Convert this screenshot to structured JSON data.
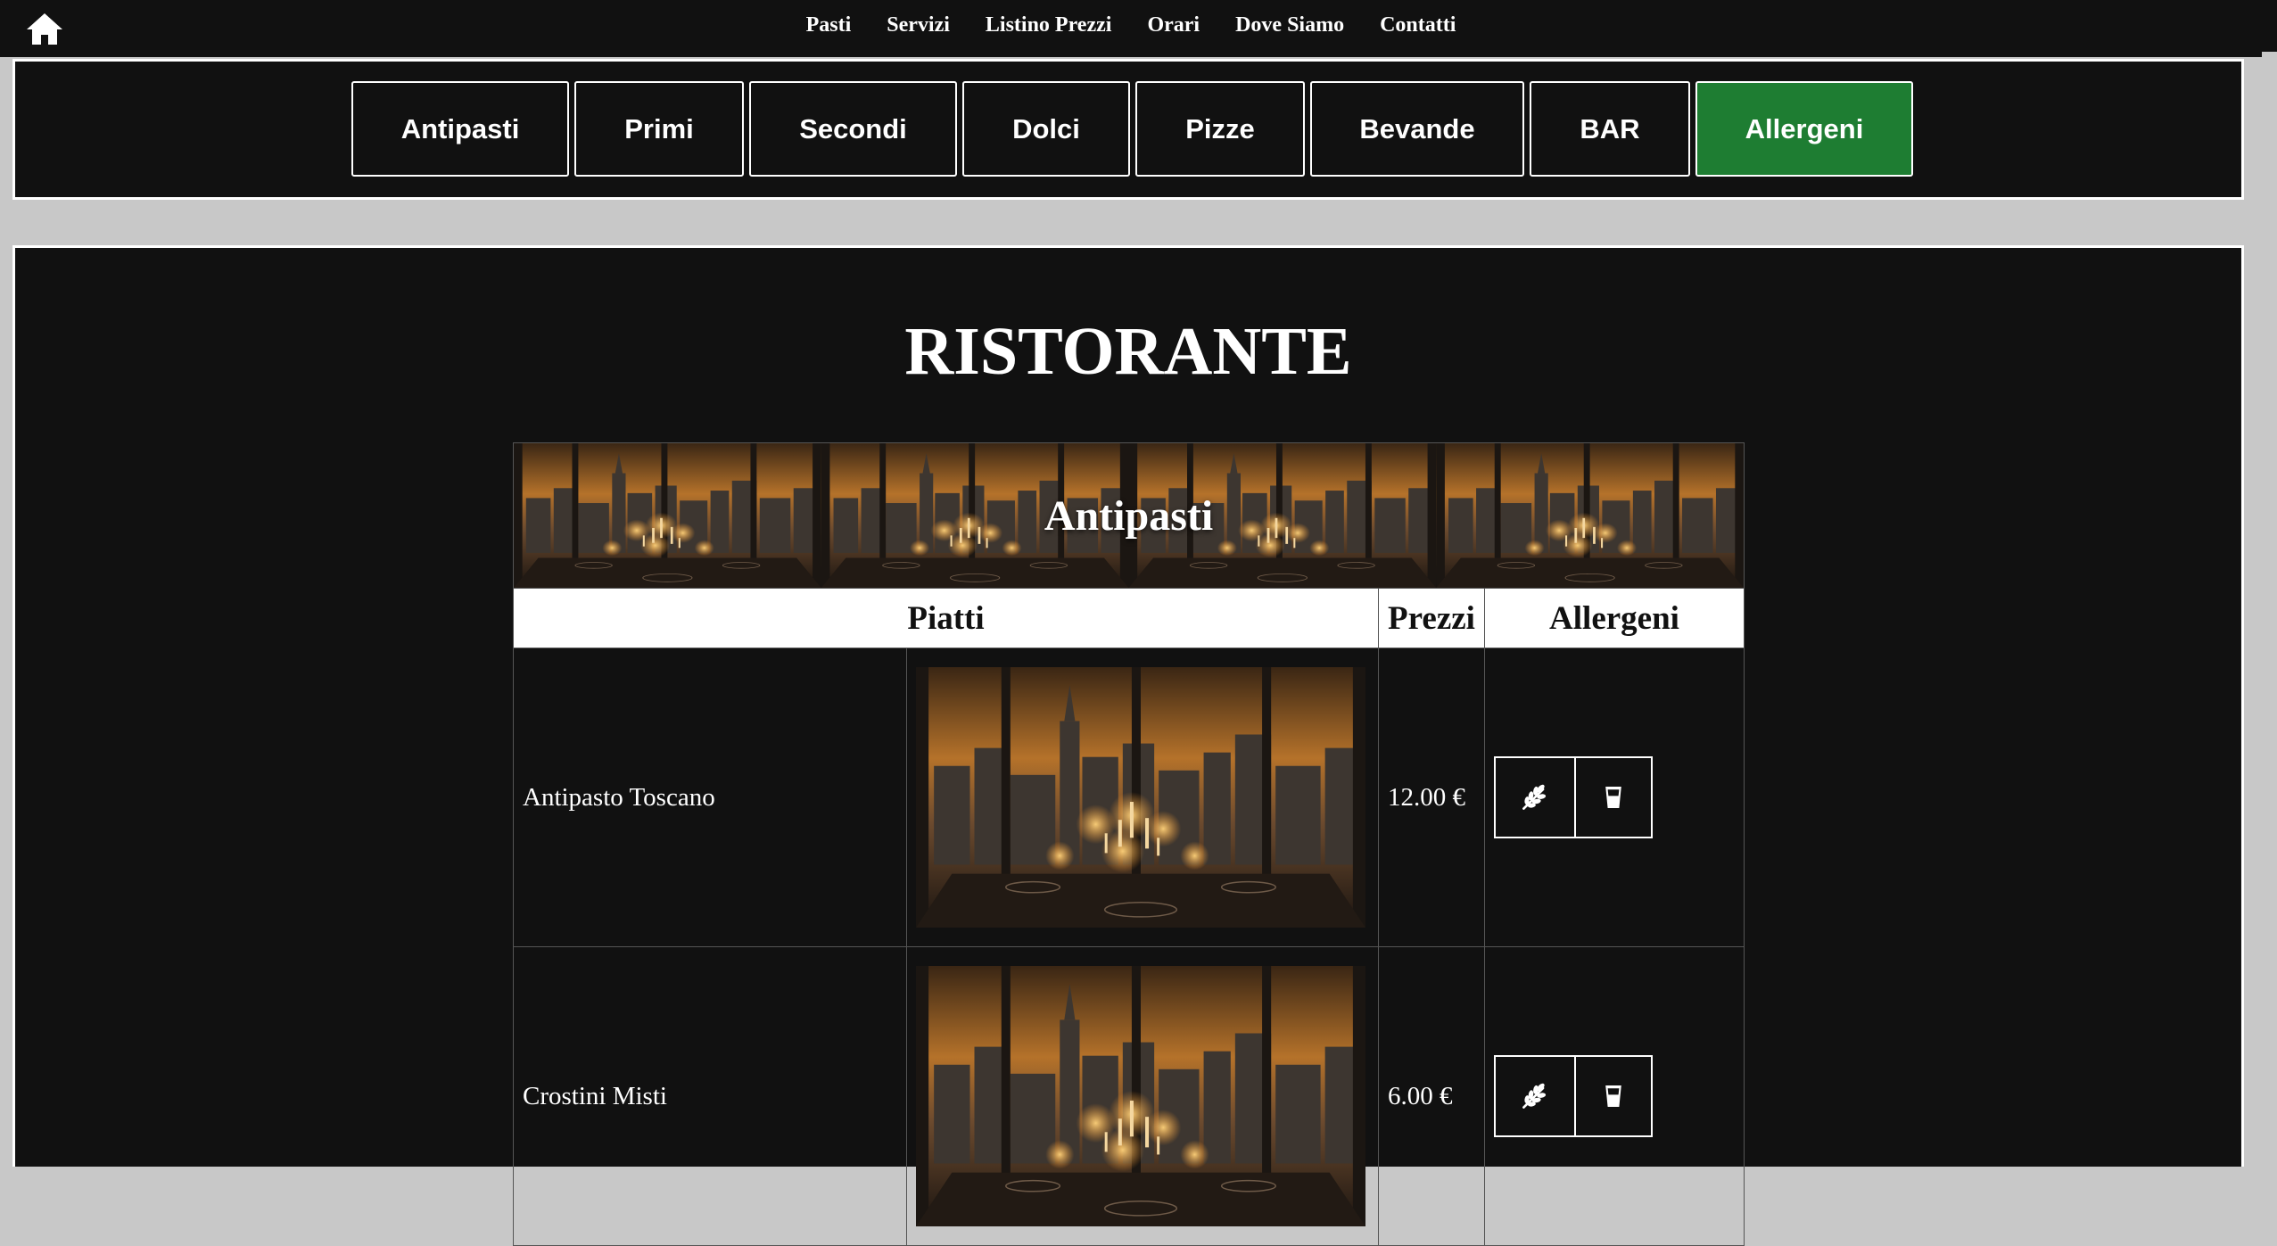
{
  "topnav": {
    "home_icon": "home-icon",
    "links": [
      "Pasti",
      "Servizi",
      "Listino Prezzi",
      "Orari",
      "Dove Siamo",
      "Contatti"
    ]
  },
  "categories": {
    "items": [
      "Antipasti",
      "Primi",
      "Secondi",
      "Dolci",
      "Pizze",
      "Bevande",
      "BAR",
      "Allergeni"
    ],
    "active": "Allergeni",
    "active_color": "#1e7d32"
  },
  "page": {
    "title": "RISTORANTE"
  },
  "menu": {
    "section_title": "Antipasti",
    "columns": [
      "Piatti",
      "Prezzi",
      "Allergeni"
    ],
    "dishes": [
      {
        "name": "Antipasto Toscano",
        "price": "12.00 €",
        "allergens": [
          "wheat-icon",
          "milk-glass-icon"
        ]
      },
      {
        "name": "Crostini Misti",
        "price": "6.00 €",
        "allergens": [
          "wheat-icon",
          "milk-glass-icon"
        ]
      }
    ]
  },
  "colors": {
    "background": "#111111",
    "accent": "#1e7d32",
    "panel_border": "#ffffff"
  }
}
